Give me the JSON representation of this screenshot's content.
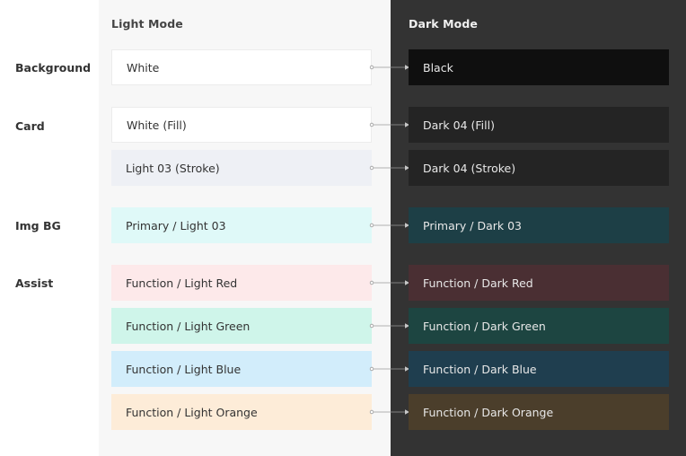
{
  "headers": {
    "light": "Light Mode",
    "dark": "Dark Mode"
  },
  "groups": [
    {
      "label": "Background"
    },
    {
      "label": "Card"
    },
    {
      "label": "Img BG"
    },
    {
      "label": "Assist"
    }
  ],
  "rows": [
    {
      "light": "White",
      "dark": "Black",
      "light_color": "#ffffff",
      "dark_color": "#0f0f0f",
      "light_border": "#ececec"
    },
    {
      "light": "White (Fill)",
      "dark": "Dark 04 (Fill)",
      "light_color": "#ffffff",
      "dark_color": "#242424",
      "light_border": "#ececec"
    },
    {
      "light": "Light 03 (Stroke)",
      "dark": "Dark 04 (Stroke)",
      "light_color": "#eef0f5",
      "dark_color": "#242424"
    },
    {
      "light": "Primary / Light 03",
      "dark": "Primary / Dark 03",
      "light_color": "#dff9f8",
      "dark_color": "#1d3f46"
    },
    {
      "light": "Function / Light Red",
      "dark": "Function / Dark Red",
      "light_color": "#fde9ea",
      "dark_color": "#4a2f33"
    },
    {
      "light": "Function / Light Green",
      "dark": "Function / Dark Green",
      "light_color": "#cff5ea",
      "dark_color": "#1d4541"
    },
    {
      "light": "Function / Light Blue",
      "dark": "Function / Dark Blue",
      "light_color": "#d2edfb",
      "dark_color": "#1f3e4f"
    },
    {
      "light": "Function / Light Orange",
      "dark": "Function / Dark Orange",
      "light_color": "#fdecd8",
      "dark_color": "#4b3e2b"
    }
  ]
}
